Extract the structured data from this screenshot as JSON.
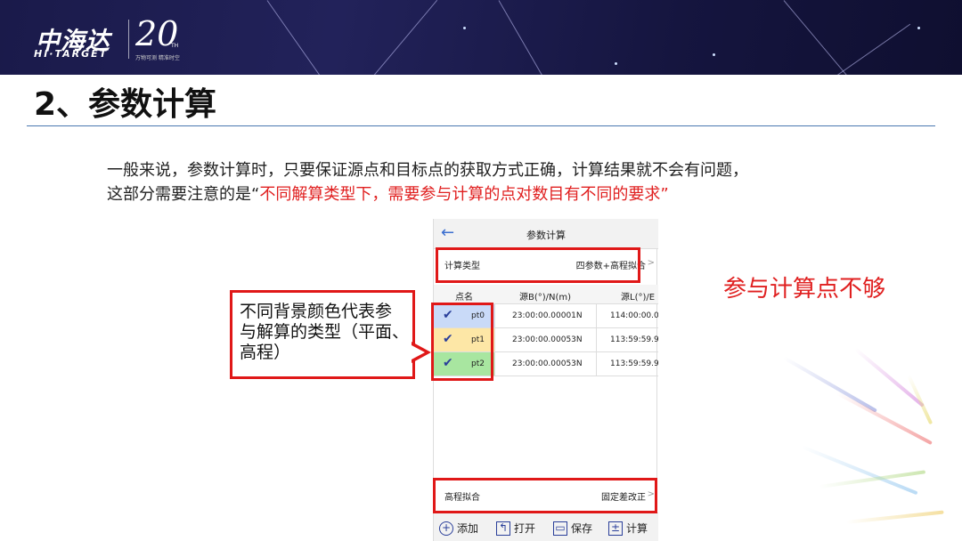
{
  "logo": {
    "cn": "中海达",
    "en": "HI·TARGET",
    "anniversary": "20",
    "th": "TH",
    "slogan": "万物可测 精准时空"
  },
  "title": "2、参数计算",
  "intro": {
    "line1": "一般来说，参数计算时，只要保证源点和目标点的获取方式正确，计算结果就不会有问题，",
    "line2_prefix": "这部分需要注意的是“",
    "line2_red": "不同解算类型下，需要参与计算的点对数目有不同的要求",
    "line2_suffix": "”"
  },
  "phone": {
    "title": "参数计算",
    "calc_type": {
      "label": "计算类型",
      "value": "四参数+高程拟合",
      "chevron": ">"
    },
    "table": {
      "headers": [
        "点名",
        "源B(°)/N(m)",
        "源L(°)/E"
      ],
      "rows": [
        {
          "name": "pt0",
          "b": "23:00:00.00001N",
          "l": "114:00:00.0",
          "color": "#c9daf8"
        },
        {
          "name": "pt1",
          "b": "23:00:00.00053N",
          "l": "113:59:59.9",
          "color": "#fde7a6"
        },
        {
          "name": "pt2",
          "b": "23:00:00.00053N",
          "l": "113:59:59.9",
          "color": "#a8e6a0"
        }
      ]
    },
    "elevation_fit": {
      "label": "高程拟合",
      "value": "固定差改正",
      "chevron": ">"
    },
    "toolbar": {
      "add": "添加",
      "open": "打开",
      "save": "保存",
      "calc": "计算"
    }
  },
  "callout": {
    "line1": "不同背景颜色代表参",
    "line2": "与解算的类型（平面、",
    "line3": "高程）"
  },
  "note": "参与计算点不够",
  "colors": {
    "accent_red": "#e01818",
    "rule_blue": "#4a78b0",
    "banner": "#1a1a4a"
  }
}
